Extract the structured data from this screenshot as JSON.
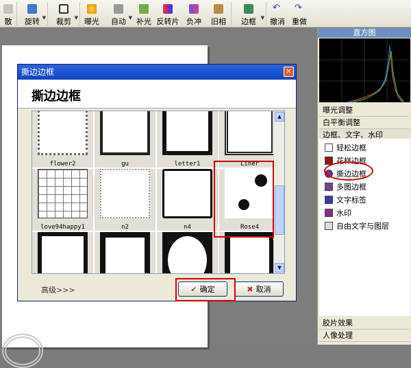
{
  "toolbar": {
    "items": [
      {
        "label": "散",
        "icon": "cut-icon"
      },
      {
        "label": "旋转",
        "icon": "rotate-icon"
      },
      {
        "label": "裁剪",
        "icon": "crop-icon"
      },
      {
        "label": "曝光",
        "icon": "exposure-icon"
      },
      {
        "label": "自动",
        "icon": "auto-icon"
      },
      {
        "label": "补光",
        "icon": "fill-light-icon"
      },
      {
        "label": "反转片",
        "icon": "reverse-film-icon"
      },
      {
        "label": "负冲",
        "icon": "cross-process-icon"
      },
      {
        "label": "旧相",
        "icon": "old-photo-icon"
      },
      {
        "label": "边框",
        "icon": "border-icon"
      },
      {
        "label": "撤消",
        "icon": "undo-icon"
      },
      {
        "label": "重做",
        "icon": "redo-icon"
      }
    ]
  },
  "panel": {
    "histogram_title": "直方图",
    "groups": [
      "曝光调整",
      "白平衡调整",
      "边框、文字、水印"
    ],
    "items": [
      {
        "label": "轻松边框",
        "color": "#444"
      },
      {
        "label": "花样边框",
        "color": "#8b1a1a"
      },
      {
        "label": "撕边边框",
        "color": "#7a2a8a"
      },
      {
        "label": "多图边框",
        "color": "#6a4a8a"
      },
      {
        "label": "文字标签",
        "color": "#3a3aa0"
      },
      {
        "label": "水印",
        "color": "#8a2a8a"
      },
      {
        "label": "自由文字与图层",
        "color": "#666"
      }
    ],
    "bottom_groups": [
      "胶片效果",
      "人像处理"
    ]
  },
  "dialog": {
    "title": "撕边边框",
    "heading": "撕边边框",
    "thumbnails": [
      {
        "caption": "flower2"
      },
      {
        "caption": "gu"
      },
      {
        "caption": "letter1"
      },
      {
        "caption": "Liner"
      },
      {
        "caption": "love94happy1"
      },
      {
        "caption": "n2"
      },
      {
        "caption": "n4"
      },
      {
        "caption": "Rose4"
      },
      {
        "caption": ""
      },
      {
        "caption": ""
      },
      {
        "caption": ""
      },
      {
        "caption": ""
      }
    ],
    "advanced_label": "高级>>>",
    "ok_label": "确定",
    "cancel_label": "取消"
  },
  "colors": {
    "title_bar": "#0c45c5",
    "highlight": "#d40000",
    "histogram_bg": "#000000"
  }
}
